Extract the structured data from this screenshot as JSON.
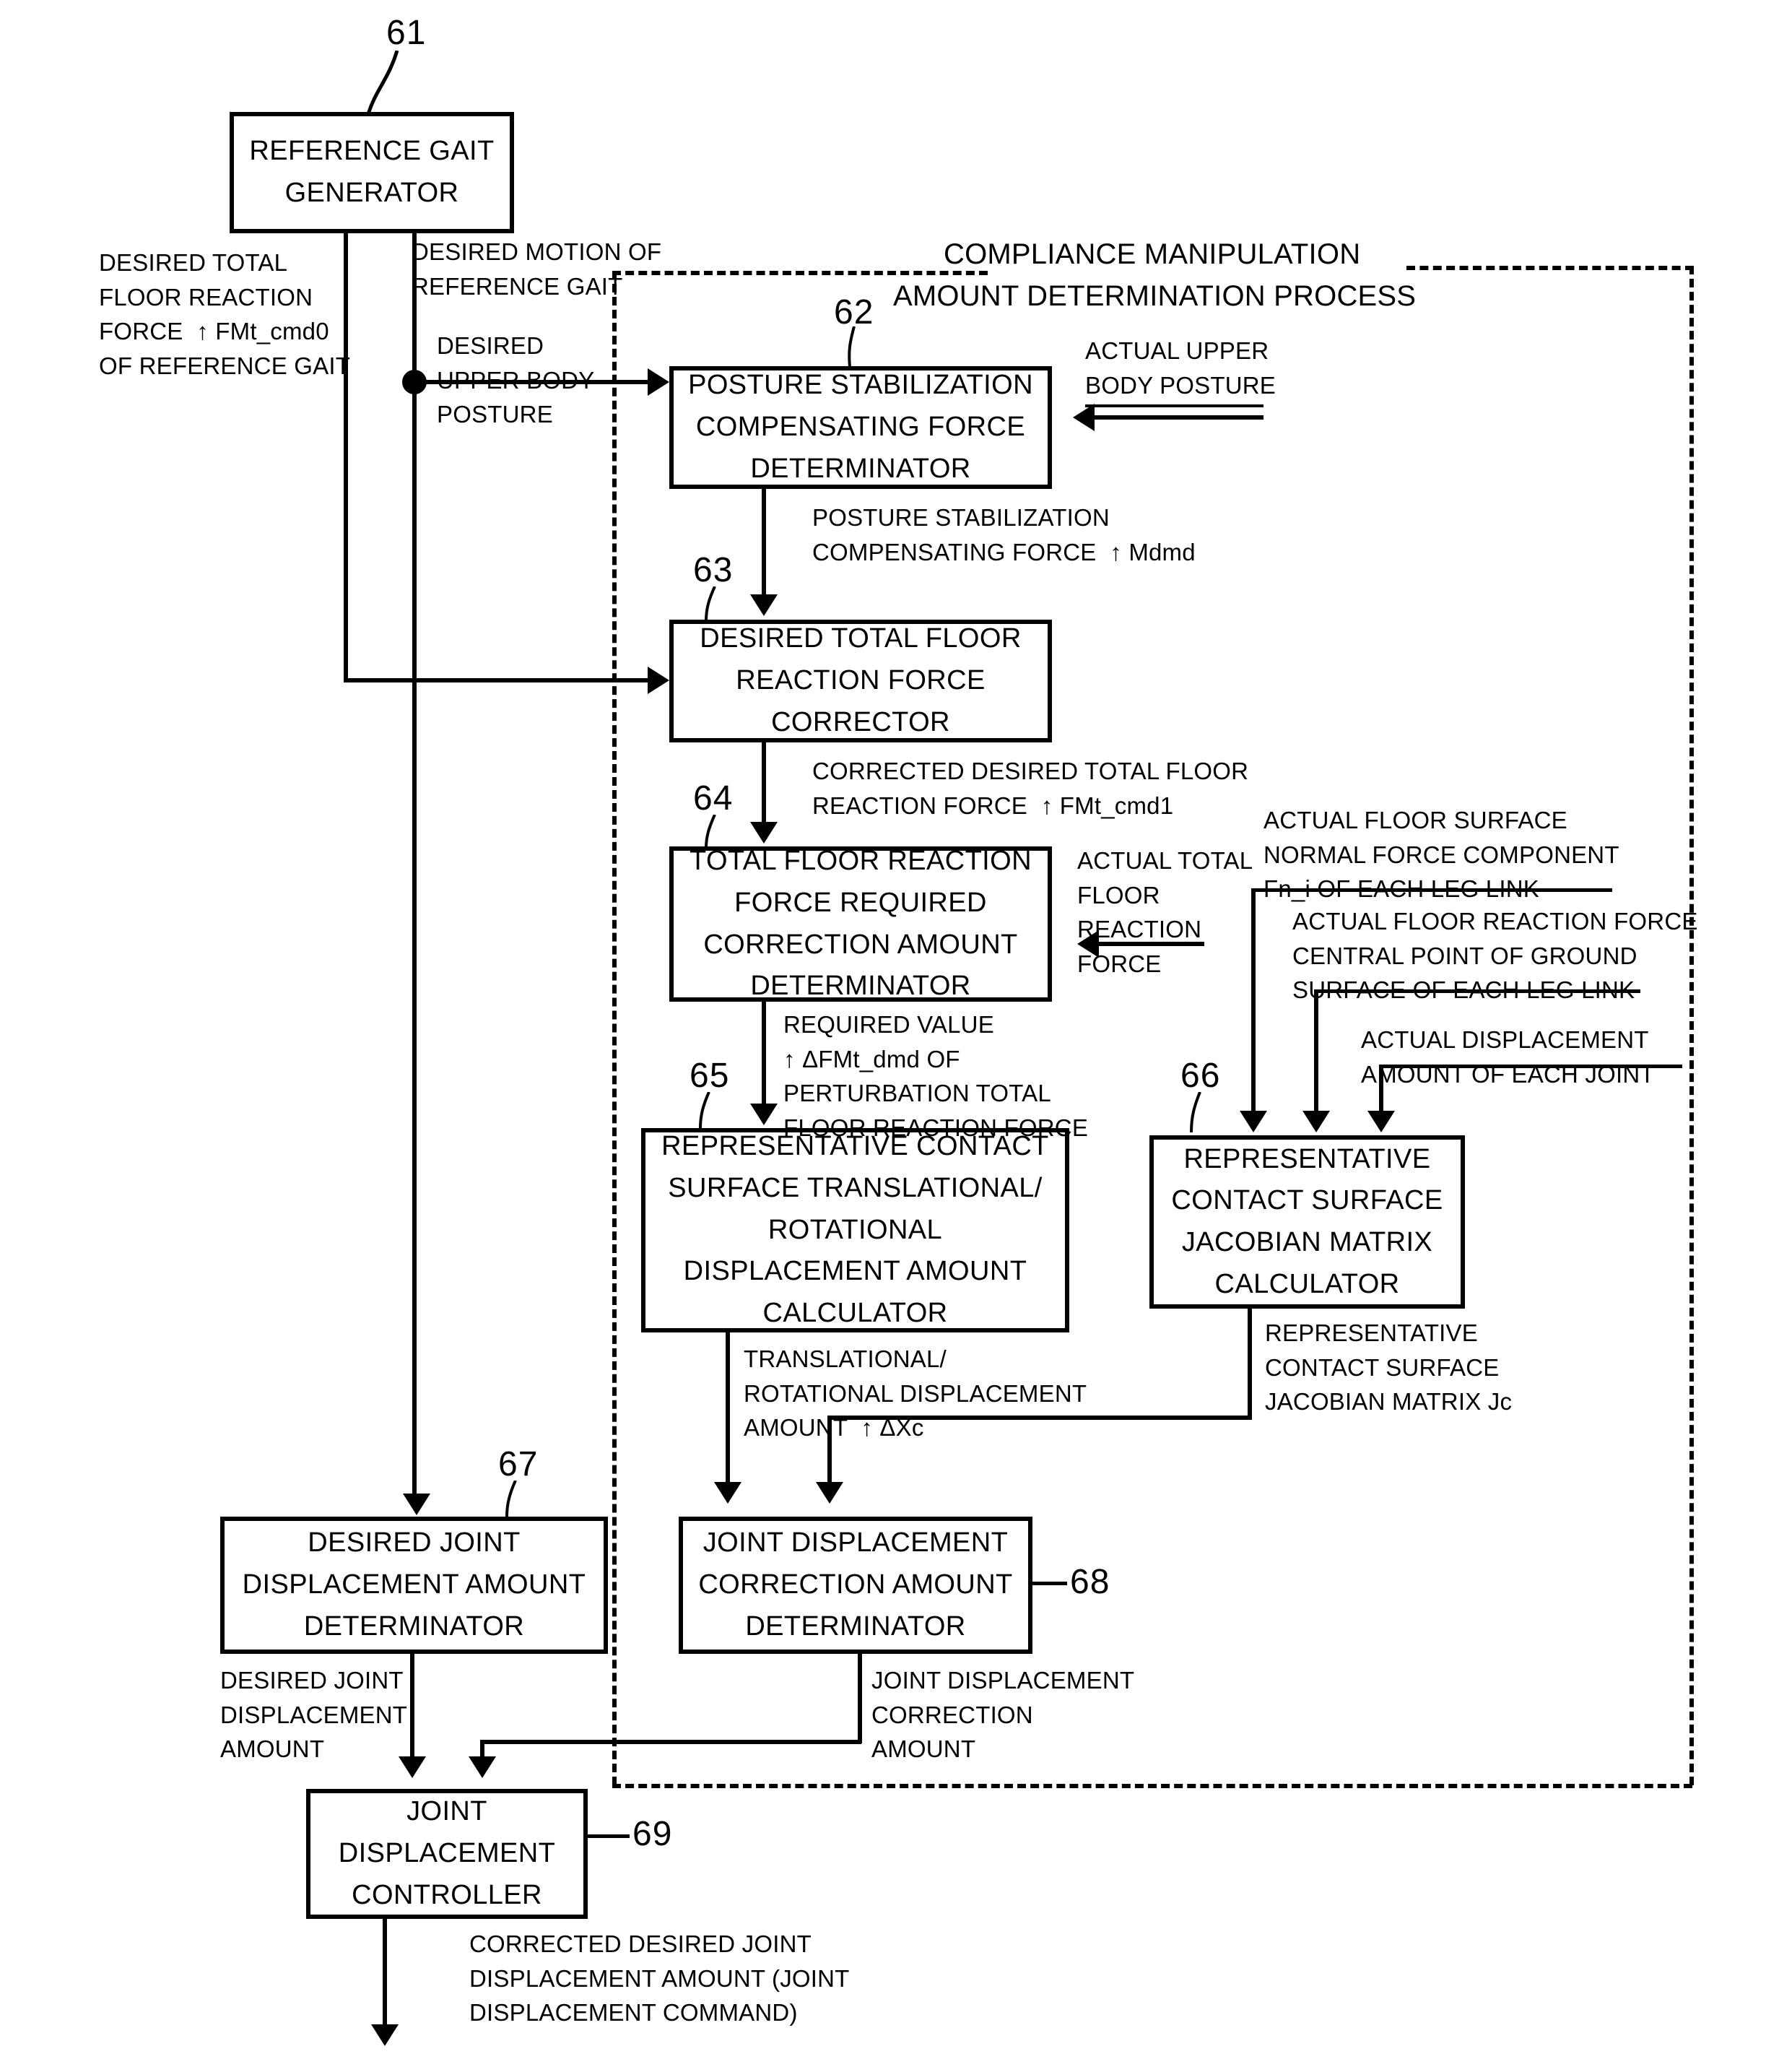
{
  "figure": {
    "title": "COMPLIANCE MANIPULATION AMOUNT DETERMINATION PROCESS",
    "title_line1": "COMPLIANCE MANIPULATION",
    "title_line2": "AMOUNT DETERMINATION PROCESS"
  },
  "blocks": [
    {
      "id": "61",
      "name": "reference-gait-generator",
      "lines": [
        "REFERENCE GAIT",
        "GENERATOR"
      ]
    },
    {
      "id": "62",
      "name": "posture-stabilization-compensating-force-determinator",
      "lines": [
        "POSTURE STABILIZATION",
        "COMPENSATING FORCE",
        "DETERMINATOR"
      ]
    },
    {
      "id": "63",
      "name": "desired-total-floor-reaction-force-corrector",
      "lines": [
        "DESIRED TOTAL FLOOR",
        "REACTION FORCE",
        "CORRECTOR"
      ]
    },
    {
      "id": "64",
      "name": "total-floor-reaction-force-required-correction-amount-determinator",
      "lines": [
        "TOTAL FLOOR REACTION",
        "FORCE REQUIRED",
        "CORRECTION AMOUNT",
        "DETERMINATOR"
      ]
    },
    {
      "id": "65",
      "name": "representative-contact-surface-translational-rotational-displacement-amount-calculator",
      "lines": [
        "REPRESENTATIVE CONTACT",
        "SURFACE TRANSLATIONAL/",
        "ROTATIONAL",
        "DISPLACEMENT AMOUNT",
        "CALCULATOR"
      ]
    },
    {
      "id": "66",
      "name": "representative-contact-surface-jacobian-matrix-calculator",
      "lines": [
        "REPRESENTATIVE",
        "CONTACT SURFACE",
        "JACOBIAN MATRIX",
        "CALCULATOR"
      ]
    },
    {
      "id": "67",
      "name": "desired-joint-displacement-amount-determinator",
      "lines": [
        "DESIRED JOINT",
        "DISPLACEMENT AMOUNT",
        "DETERMINATOR"
      ]
    },
    {
      "id": "68",
      "name": "joint-displacement-correction-amount-determinator",
      "lines": [
        "JOINT DISPLACEMENT",
        "CORRECTION AMOUNT",
        "DETERMINATOR"
      ]
    },
    {
      "id": "69",
      "name": "joint-displacement-controller",
      "lines": [
        "JOINT",
        "DISPLACEMENT",
        "CONTROLLER"
      ]
    }
  ],
  "numerals": {
    "n61": "61",
    "n62": "62",
    "n63": "63",
    "n64": "64",
    "n65": "65",
    "n66": "66",
    "n67": "67",
    "n68": "68",
    "n69": "69"
  },
  "signals": {
    "desired_total_frf": "DESIRED TOTAL\nFLOOR REACTION\nFORCE  ↑ FMt_cmd0\nOF REFERENCE GAIT",
    "desired_motion_of_reference_gait": "DESIRED MOTION OF\nREFERENCE GAIT",
    "desired_upper_body_posture": "DESIRED\nUPPER BODY\nPOSTURE",
    "actual_upper_body_posture": "ACTUAL UPPER\nBODY POSTURE",
    "posture_stab_comp_force": "POSTURE STABILIZATION\nCOMPENSATING FORCE  ↑ Mdmd",
    "corrected_desired_total_frf": "CORRECTED DESIRED TOTAL FLOOR\nREACTION FORCE  ↑ FMt_cmd1",
    "actual_total_frf": "ACTUAL TOTAL\nFLOOR\nREACTION\nFORCE",
    "required_value": "REQUIRED VALUE\n↑ ΔFMt_dmd OF\nPERTURBATION TOTAL\nFLOOR REACTION FORCE",
    "actual_floor_surface_normal": "ACTUAL FLOOR SURFACE\nNORMAL FORCE COMPONENT\nFn_i OF EACH LEG LINK",
    "actual_frf_central_point": "ACTUAL FLOOR REACTION FORCE\nCENTRAL POINT OF GROUND\nSURFACE OF EACH LEG LINK",
    "actual_displacement_each_joint": "ACTUAL DISPLACEMENT\nAMOUNT OF EACH JOINT",
    "translational_rotational_displacement": "TRANSLATIONAL/\nROTATIONAL DISPLACEMENT\nAMOUNT  ↑ ΔXc",
    "representative_jacobian": "REPRESENTATIVE\nCONTACT SURFACE\nJACOBIAN MATRIX Jc",
    "desired_joint_displacement_amount": "DESIRED JOINT\nDISPLACEMENT\nAMOUNT",
    "joint_displacement_correction_amount": "JOINT DISPLACEMENT\nCORRECTION\nAMOUNT",
    "corrected_desired_joint_displacement": "CORRECTED DESIRED JOINT\nDISPLACEMENT AMOUNT (JOINT\nDISPLACEMENT COMMAND)"
  },
  "colors": {
    "ink": "#000000",
    "paper": "#ffffff"
  }
}
